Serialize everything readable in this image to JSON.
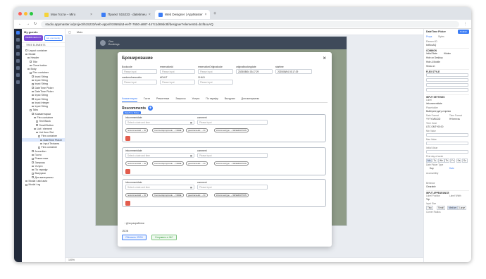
{
  "browser": {
    "tabs": [
      {
        "title": "Мои Гости – Miro",
        "color": "#f5d33a",
        "active": false
      },
      {
        "title": "Проект 515233 · datetimeu",
        "color": "#3c7df5",
        "active": false
      },
      {
        "title": "Web Designer | AppMaster",
        "color": "#3c7df5",
        "active": true
      }
    ],
    "url": "studio.appmaster.io/project/515233/web-apps/01958da3-eef7-7650-a887-447c1d69dc8f/designer?elementId=bcf6ouAQ"
  },
  "left_panel": {
    "project": "My guests",
    "badge1": "WEB/B DEPLOY",
    "badge2": "Ad- community",
    "tabs": "TREE ELEMENTS",
    "tree": [
      "Layout container",
      "Modal",
      "Header",
      "Title",
      "Close button",
      "Body",
      "Flex container",
      "Input String",
      "Input String",
      "Input String",
      "DateTime Picker",
      "DateTime Picker",
      "Input String",
      "Input String",
      "Input Integer",
      "Input String",
      "Tabs",
      "Комментарии",
      "Flex container",
      "Text Block",
      "Small Button",
      "List / element",
      "List Item Slot",
      "Flex container",
      "DateTime Picker",
      "Input Textarea",
      "Flex container",
      "Accordion",
      "Гости",
      "Ремонтные",
      "Запросы",
      "Услуги",
      "По тарифу",
      "Выгрузки",
      "Доп.материалы",
      "Modal / add auto",
      "Modal / eg"
    ],
    "selected_index": 24
  },
  "center": {
    "breadcrumb": "Main",
    "guest_name": "Gen",
    "guest_sub": "Bookings",
    "zoom": "100%"
  },
  "modal": {
    "title": "Бронирование",
    "close": "×",
    "row1": [
      {
        "label": "Bookcode",
        "placeholder": "Please input"
      },
      {
        "label": "reservationid",
        "placeholder": "Please input"
      },
      {
        "label": "reservationOriginalcode",
        "placeholder": "Please input"
      },
      {
        "label": "originalbookingdate",
        "value": "2025/08/04 03:17:29"
      },
      {
        "label": "startime",
        "value": "2025/08/04 03:17:29"
      }
    ],
    "row2": [
      {
        "label": "numberofnewouths",
        "placeholder": "Please input"
      },
      {
        "label": "ADULT",
        "placeholder": "Please input"
      },
      {
        "label": "CHILD",
        "placeholder": "Please input"
      }
    ],
    "tabs": [
      "Комментарии",
      "Гости",
      "Ремонтные",
      "Запросы",
      "Услуги",
      "По тарифу",
      "Выгрузки",
      "Доп.материалы"
    ],
    "section": "Rescomments",
    "badge": "DateTime Picker",
    "cards": [
      {
        "date_label": "infcommentdate",
        "date_placeholder": "Select a date and time",
        "comment_label": "comment",
        "comment_placeholder": "Please input"
      },
      {
        "date_label": "infcommentdate",
        "date_placeholder": "Select a date and time",
        "comment_label": "comment",
        "comment_placeholder": "Please input"
      },
      {
        "date_label": "infcommentdate",
        "date_placeholder": "Select a date and time",
        "comment_label": "comment",
        "comment_placeholder": "Please input"
      }
    ],
    "chips": [
      "rescommentsId → ID",
      "Commentsproprcode → NAME",
      "guestnameids → ID",
      "infcommentype → RESERVATION"
    ],
    "dev_link": "Для разработки",
    "json_label": "JSON",
    "btn_update": "Обновить JSON",
    "btn_send": "Отправить в INC"
  },
  "right_panel": {
    "element": "DateTime Picker",
    "publish": "Publish",
    "tabs": [
      "Props",
      "Styles"
    ],
    "element_id_label": "Element ID",
    "element_id": "bcf6ouAQ",
    "common": "COMMON",
    "initial_state": "Initial State",
    "hidden": "Hidden",
    "on_desktop": "Hide on Desktop",
    "hide_mobile": "Hide & Mobile",
    "show_on": "Show on",
    "flex_style": "FLEX STYLE",
    "input_settings": "INPUT SETTINGS",
    "label": "Label",
    "label_val": "infcommentdate",
    "placeholder": "Placeholder",
    "placeholder_val": "Выберите дату и время",
    "date_format": "Date Format",
    "date_format_val": "YYYY-MM-DD",
    "time_format": "Time Format",
    "time_format_val": "HH:mm:ss",
    "time_zone": "Time Zone",
    "time_zone_val": "UTC GMT+00:00",
    "min_value": "Min Value",
    "max_value": "Max Value",
    "initial_value": "Initial Value",
    "first_day": "First day of week",
    "days": [
      "Mo",
      "Tu",
      "We",
      "Th",
      "Fr",
      "Sa",
      "Su"
    ],
    "view": "Date Picker Type",
    "view_vals": [
      "Day",
      "Date"
    ],
    "accessibility": "Accessibility",
    "behavior": "Behavior",
    "clearable": "Clearable",
    "input_appearance": "INPUT APPEARANCE",
    "label_position": "Label Position",
    "label_width": "Label Width",
    "label_pos_val": "Top",
    "size": "Input Size",
    "sizes": [
      "Tiny",
      "Small",
      "Medium",
      "Large"
    ],
    "corner": "Corner Radius"
  }
}
